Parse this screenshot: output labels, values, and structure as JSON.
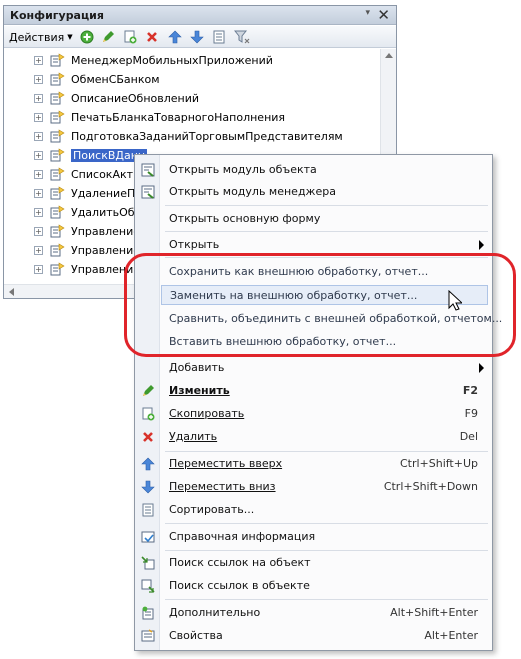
{
  "window": {
    "title": "Конфигурация",
    "actions_label": "Действия"
  },
  "tree_items": [
    {
      "label": "МенеджерМобильныхПриложений",
      "selected": false
    },
    {
      "label": "ОбменСБанком",
      "selected": false
    },
    {
      "label": "ОписаниеОбновлений",
      "selected": false
    },
    {
      "label": "ПечатьБланкаТоварногоНаполнения",
      "selected": false
    },
    {
      "label": "ПодготовкаЗаданийТорговымПредставителям",
      "selected": false
    },
    {
      "label": "ПоискВДанн",
      "selected": true
    },
    {
      "label": "СписокАктив",
      "selected": false
    },
    {
      "label": "УдалениеПо",
      "selected": false
    },
    {
      "label": "УдалитьОбр",
      "selected": false
    },
    {
      "label": "Управление",
      "selected": false
    },
    {
      "label": "Управление",
      "selected": false
    },
    {
      "label": "Управлени",
      "selected": false
    }
  ],
  "menu": {
    "open_object_module": "Открыть модуль объекта",
    "open_manager_module": "Открыть модуль менеджера",
    "open_main_form": "Открыть основную форму",
    "open": "Открыть",
    "save_external": "Сохранить как внешнюю обработку, отчет...",
    "replace_external": "Заменить на внешнюю обработку, отчет...",
    "compare_merge": "Сравнить, объединить с внешней обработкой, отчетом...",
    "insert_external": "Вставить внешнюю обработку, отчет...",
    "add": "Добавить",
    "edit": "Изменить",
    "edit_sc": "F2",
    "copy": "Скопировать",
    "copy_sc": "F9",
    "delete": "Удалить",
    "delete_sc": "Del",
    "move_up": "Переместить вверх",
    "move_up_sc": "Ctrl+Shift+Up",
    "move_down": "Переместить вниз",
    "move_down_sc": "Ctrl+Shift+Down",
    "sort": "Сортировать...",
    "help": "Справочная информация",
    "find_refs_to": "Поиск ссылок на объект",
    "find_refs_in": "Поиск ссылок в объекте",
    "advanced": "Дополнительно",
    "advanced_sc": "Alt+Shift+Enter",
    "properties": "Свойства",
    "properties_sc": "Alt+Enter"
  },
  "colors": {
    "highlight_border": "#e0242a",
    "selection": "#3a66c8"
  }
}
